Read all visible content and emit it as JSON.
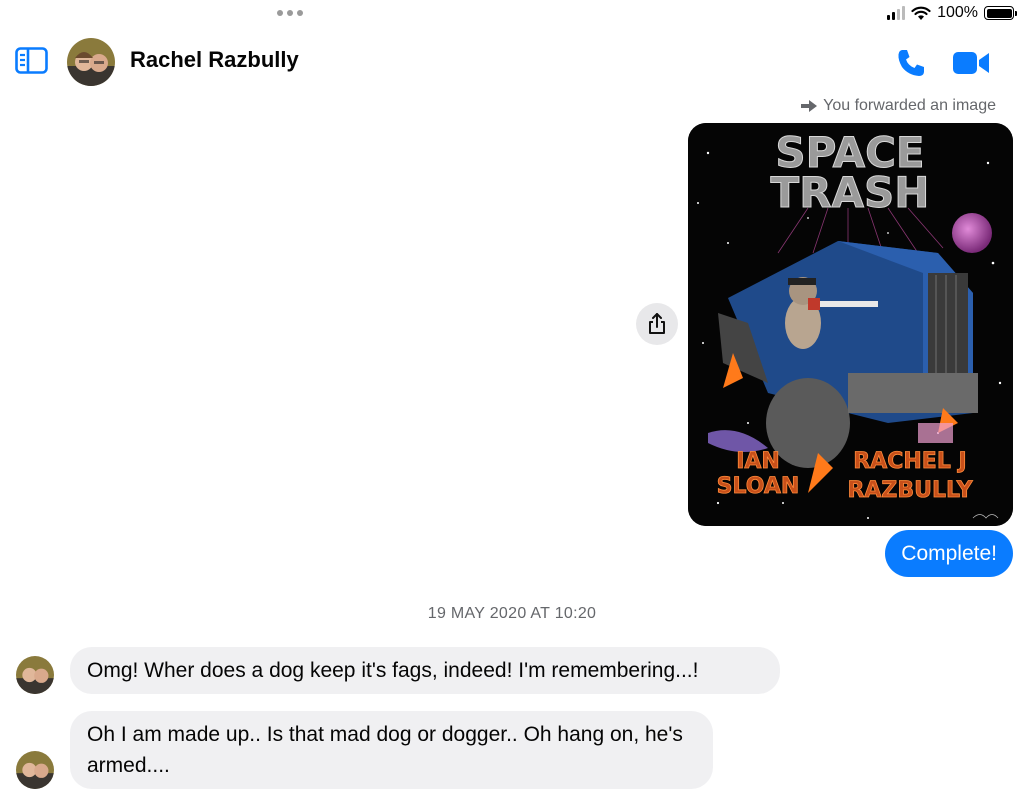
{
  "status": {
    "battery": "100%",
    "battery_level": 1.0
  },
  "header": {
    "contact_name": "Rachel Razbully"
  },
  "conversation": {
    "forward_note": "You forwarded an image",
    "image": {
      "title_line1": "SPACE",
      "title_line2": "TRASH",
      "author1_line1": "IAN",
      "author1_line2": "SLOAN",
      "author2_line1": "RACHEL J",
      "author2_line2": "RAZBULLY"
    },
    "outgoing_text": "Complete!",
    "timestamp": "19 MAY 2020 AT 10:20",
    "incoming": [
      "Omg! Wher does a dog keep it's fags, indeed! I'm remembering...!",
      "Oh I am made up.. Is that mad dog or dogger.. Oh hang on, he's armed...."
    ]
  },
  "colors": {
    "accent": "#0a7cff",
    "bubble_in": "#f0f0f2",
    "muted": "#65676b"
  }
}
